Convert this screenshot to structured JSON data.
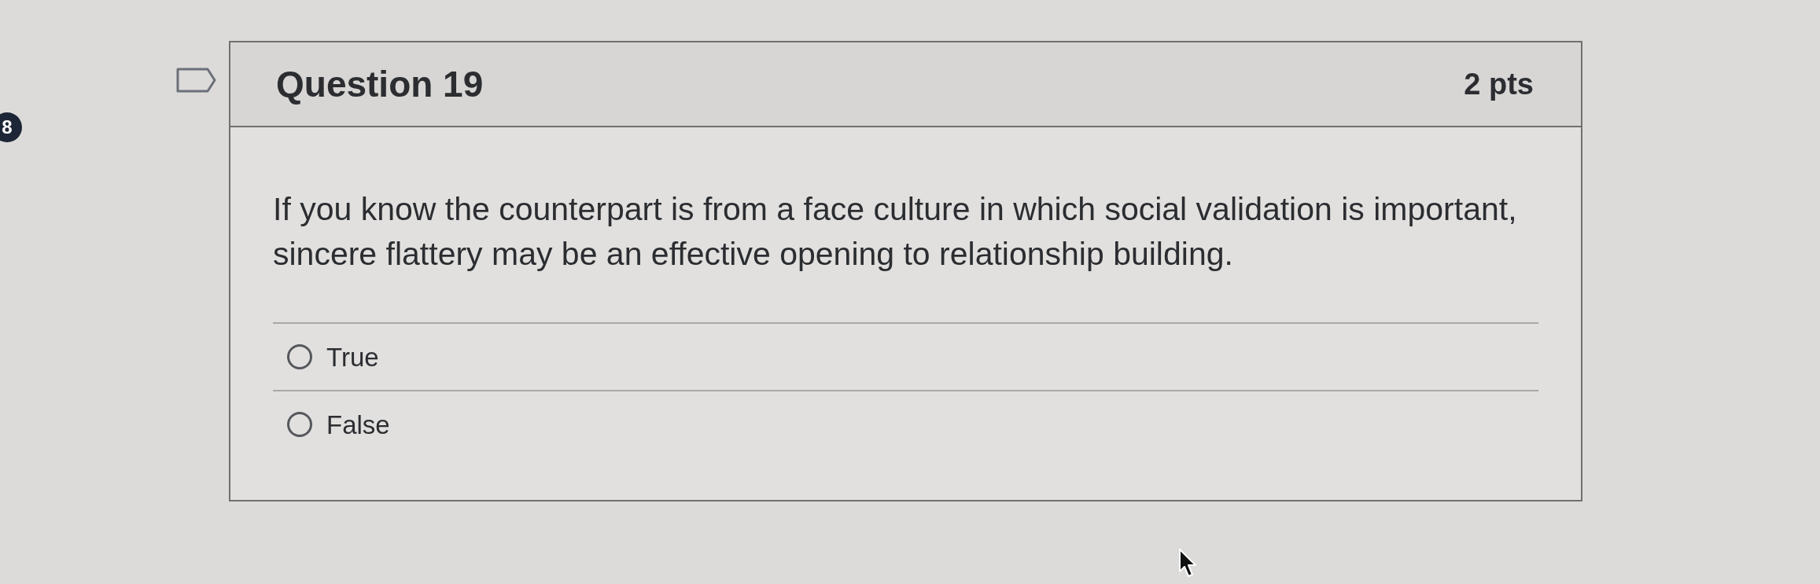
{
  "question_badge": {
    "text": "8"
  },
  "question": {
    "flagged": false,
    "title": "Question 19",
    "points": "2 pts",
    "text": "If you know the counterpart is from a face culture in which social validation is important, sincere flattery may be an effective opening to relationship building.",
    "answers": [
      {
        "label": "True",
        "selected": false
      },
      {
        "label": "False",
        "selected": false
      }
    ]
  }
}
